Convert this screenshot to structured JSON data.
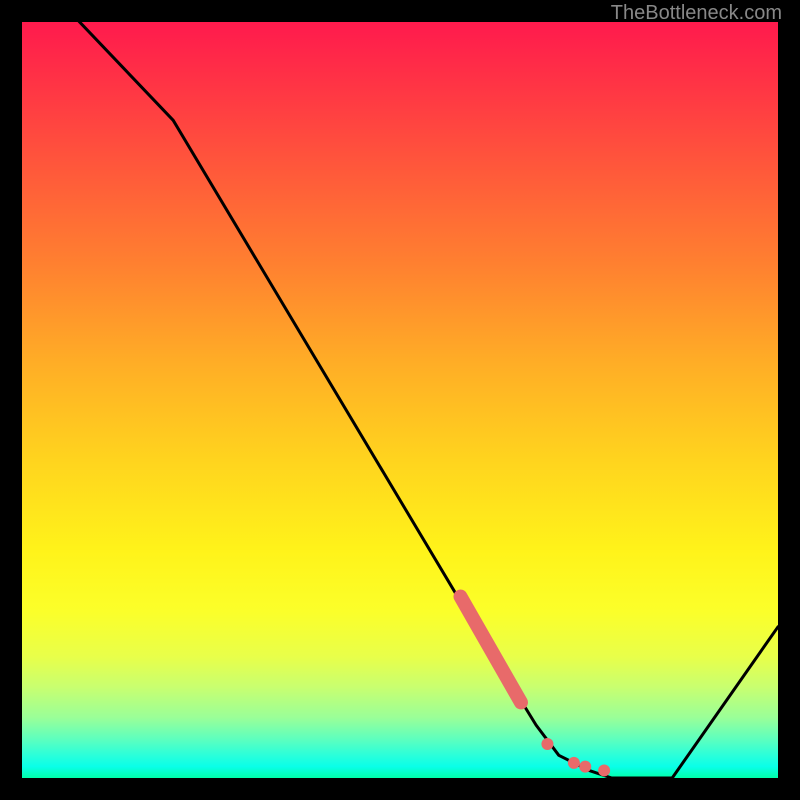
{
  "watermark": "TheBottleneck.com",
  "chart_data": {
    "type": "line",
    "title": "",
    "xlabel": "",
    "ylabel": "",
    "xlim": [
      0,
      100
    ],
    "ylim": [
      0,
      100
    ],
    "x": [
      0,
      20,
      60,
      68,
      71,
      75,
      78,
      82,
      86,
      100
    ],
    "values": [
      108,
      87,
      20,
      7,
      3,
      1,
      0,
      0,
      0,
      20
    ],
    "highlight_segment": {
      "x_start": 58,
      "x_end": 66,
      "y_start": 24,
      "y_end": 10
    },
    "highlight_dots": [
      {
        "x": 69.5,
        "y": 4.5
      },
      {
        "x": 73,
        "y": 2
      },
      {
        "x": 74.5,
        "y": 1.5
      },
      {
        "x": 77,
        "y": 1
      }
    ],
    "colors": {
      "line": "#000000",
      "highlight": "#e86a6a",
      "gradient_top": "#ff1a4d",
      "gradient_bottom": "#00ffaa"
    }
  }
}
